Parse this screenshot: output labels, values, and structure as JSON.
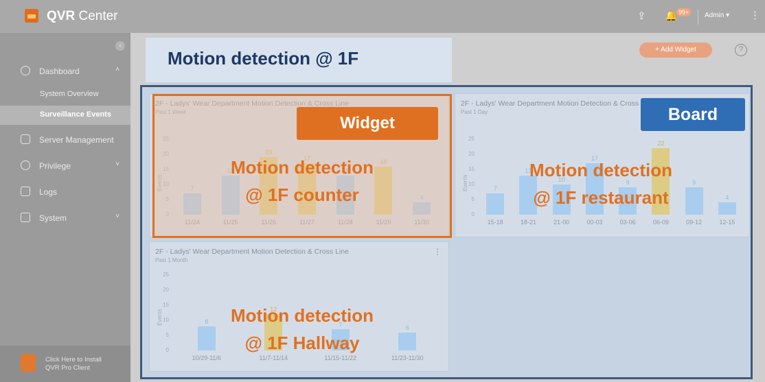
{
  "app": {
    "title_bold": "QVR",
    "title_rest": " Center"
  },
  "topbar": {
    "notification_badge": "99+",
    "user_label": "Admin ▾",
    "more_icon": "kebab-icon"
  },
  "sidebar": {
    "collapse_glyph": "‹",
    "items": [
      {
        "label": "Dashboard",
        "chevron": "˄"
      },
      {
        "label": "System Overview"
      },
      {
        "label": "Surveillance Events"
      },
      {
        "label": "Server Management"
      },
      {
        "label": "Privilege",
        "chevron": "˅"
      },
      {
        "label": "Logs"
      },
      {
        "label": "System",
        "chevron": "˅"
      }
    ],
    "install": {
      "line1": "Click Here to Install",
      "line2": "QVR Pro Client"
    }
  },
  "header": {
    "title": "Motion detection @ 1F",
    "add_widget": "+ Add Widget",
    "help": "?"
  },
  "colors": {
    "accent": "#e07021",
    "board_border": "#3b5a80",
    "bar_blue": "#a9cdee",
    "bar_gold": "#dccc86"
  },
  "callouts": {
    "widget_tag": "Widget",
    "board_tag": "Board",
    "w1": [
      "Motion detection",
      "@ 1F counter"
    ],
    "w2": [
      "Motion detection",
      "@ 1F restaurant"
    ],
    "w3": [
      "Motion detection",
      "@ 1F Hallway"
    ]
  },
  "widgets": [
    {
      "title": "2F - Ladys' Wear Department Motion Detection & Cross Line",
      "subtitle": "Past 1 Week",
      "ylabel": "Events",
      "chart_data": {
        "type": "bar",
        "categories": [
          "11/24",
          "11/25",
          "11/26",
          "11/27",
          "11/28",
          "11/29",
          "11/30"
        ],
        "values": [
          7,
          13,
          19,
          17,
          13,
          16,
          4
        ],
        "highlight": [
          false,
          false,
          true,
          true,
          false,
          true,
          false
        ],
        "ylim": [
          0,
          25
        ],
        "yticks": [
          0,
          5,
          10,
          15,
          20,
          25
        ]
      }
    },
    {
      "title": "2F - Ladys' Wear Department Motion Detection & Cross Line",
      "subtitle": "Past 1 Day",
      "ylabel": "Events",
      "chart_data": {
        "type": "bar",
        "categories": [
          "15-18",
          "18-21",
          "21-00",
          "00-03",
          "03-06",
          "06-09",
          "09-12",
          "12-15"
        ],
        "values": [
          7,
          13,
          10,
          17,
          9,
          22,
          9,
          4
        ],
        "highlight": [
          false,
          false,
          false,
          false,
          false,
          true,
          false,
          false
        ],
        "ylim": [
          0,
          25
        ],
        "yticks": [
          0,
          5,
          10,
          15,
          20,
          25
        ]
      }
    },
    {
      "title": "2F - Ladys' Wear Department Motion Detection & Cross Line",
      "subtitle": "Past 1 Month",
      "ylabel": "Events",
      "chart_data": {
        "type": "bar",
        "categories": [
          "10/29-11/6",
          "11/7-11/14",
          "11/15-11/22",
          "11/23-11/30"
        ],
        "values": [
          8,
          12,
          7,
          6
        ],
        "highlight": [
          false,
          true,
          false,
          false
        ],
        "ylim": [
          0,
          25
        ],
        "yticks": [
          0,
          5,
          10,
          15,
          20,
          25
        ]
      }
    }
  ]
}
